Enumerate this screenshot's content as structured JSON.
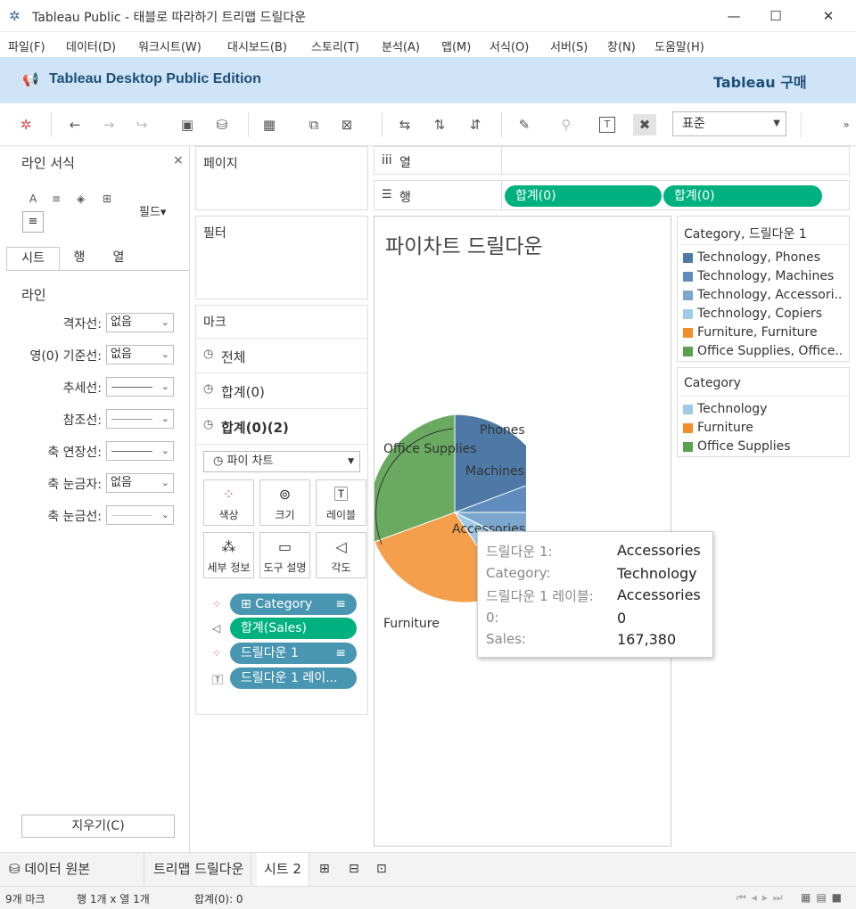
{
  "window": {
    "title": "Tableau Public - 태블로 따라하기 트리맵 드릴다운",
    "min": "—",
    "max": "☐",
    "close": "✕"
  },
  "menu": [
    "파일(F)",
    "데이터(D)",
    "워크시트(W)",
    "대시보드(B)",
    "스토리(T)",
    "분석(A)",
    "맵(M)",
    "서식(O)",
    "서버(S)",
    "창(N)",
    "도움말(H)"
  ],
  "banner": {
    "edition": "Tableau Desktop Public Edition",
    "buy": "Tableau 구매"
  },
  "toolbar": {
    "fit": "표준"
  },
  "format_pane": {
    "title": "라인 서식",
    "close": "×",
    "fields": "필드▾",
    "tabs": [
      "시트",
      "행",
      "열"
    ],
    "section": "라인",
    "rows": [
      {
        "label": "격자선:",
        "value": "없음"
      },
      {
        "label": "영(0) 기준선:",
        "value": "없음"
      },
      {
        "label": "추세선:",
        "value": ""
      },
      {
        "label": "참조선:",
        "value": ""
      },
      {
        "label": "축 연장선:",
        "value": ""
      },
      {
        "label": "축 눈금자:",
        "value": "없음"
      },
      {
        "label": "축 눈금선:",
        "value": ""
      }
    ],
    "clear": "지우기(C)"
  },
  "shelves": {
    "pages": "페이지",
    "filters": "필터",
    "columns": "열",
    "rows": "행",
    "row_pills": [
      "합계(0)",
      "합계(0)"
    ]
  },
  "marks": {
    "title": "마크",
    "cards": [
      "전체",
      "합계(0)",
      "합계(0)(2)"
    ],
    "type": "파이 차트",
    "buttons": [
      "색상",
      "크기",
      "레이블",
      "세부 정보",
      "도구 설명",
      "각도"
    ],
    "encodings": [
      "Category",
      "합계(Sales)",
      "드릴다운 1",
      "드릴다운 1 레이..."
    ]
  },
  "view": {
    "title": "파이차트 드릴다운",
    "labels": [
      "Phones",
      "Machines",
      "Accessories",
      "Office Supplies",
      "Furniture"
    ]
  },
  "legend1": {
    "title": "Category, 드릴다운 1",
    "items": [
      {
        "label": "Technology, Phones",
        "color": "#4e79a7"
      },
      {
        "label": "Technology, Machines",
        "color": "#5f8cbd"
      },
      {
        "label": "Technology, Accessori..",
        "color": "#7ba7cf"
      },
      {
        "label": "Technology, Copiers",
        "color": "#a0cbe8"
      },
      {
        "label": "Furniture, Furniture",
        "color": "#f28e2b"
      },
      {
        "label": "Office Supplies, Office..",
        "color": "#59a14f"
      }
    ]
  },
  "legend2": {
    "title": "Category",
    "items": [
      {
        "label": "Technology",
        "color": "#a0cbe8"
      },
      {
        "label": "Furniture",
        "color": "#f28e2b"
      },
      {
        "label": "Office Supplies",
        "color": "#59a14f"
      }
    ]
  },
  "tooltip": {
    "rows": [
      {
        "label": "드릴다운 1:",
        "value": "Accessories"
      },
      {
        "label": "Category:",
        "value": "Technology"
      },
      {
        "label": "드릴다운 1 레이블:",
        "value": "Accessories"
      },
      {
        "label": "0:",
        "value": "0"
      },
      {
        "label": "Sales:",
        "value": "167,380"
      }
    ]
  },
  "sheet_tabs": {
    "datasource": "데이터 원본",
    "tabs": [
      "트리맵 드릴다운",
      "시트 2"
    ]
  },
  "status": {
    "marks": "9개 마크",
    "rowscols": "행 1개  x  열 1개",
    "sum": "합계(0): 0"
  }
}
